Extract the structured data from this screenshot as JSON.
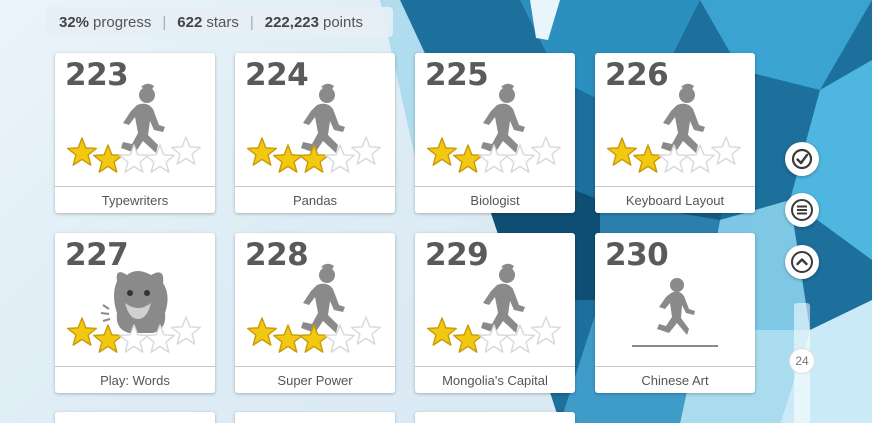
{
  "status": {
    "progress_value": "32%",
    "progress_label": "progress",
    "stars_value": "622",
    "stars_label": "stars",
    "points_value": "222,223",
    "points_label": "points"
  },
  "levels": [
    {
      "number": "223",
      "title": "Typewriters",
      "stars": 2,
      "art": "runner-icon"
    },
    {
      "number": "224",
      "title": "Pandas",
      "stars": 3,
      "art": "runner-icon"
    },
    {
      "number": "225",
      "title": "Biologist",
      "stars": 2,
      "art": "runner-icon"
    },
    {
      "number": "226",
      "title": "Keyboard Layout",
      "stars": 2,
      "art": "runner-icon"
    },
    {
      "number": "227",
      "title": "Play: Words",
      "stars": 2,
      "art": "monster-icon"
    },
    {
      "number": "228",
      "title": "Super Power",
      "stars": 3,
      "art": "runner-icon"
    },
    {
      "number": "229",
      "title": "Mongolia's Capital",
      "stars": 2,
      "art": "runner-icon"
    },
    {
      "number": "230",
      "title": "Chinese Art",
      "stars": 0,
      "art": "runner-start-icon"
    }
  ],
  "stars_total_per_level": 5,
  "colors": {
    "star_gold": "#f2c811",
    "star_outline": "#d8d8d8",
    "figure_gray": "#8a8a8a"
  },
  "sidebar": {
    "check_icon": "check-circle-icon",
    "menu_icon": "hamburger-icon",
    "up_icon": "chevron-up-icon",
    "page_number": "24"
  }
}
